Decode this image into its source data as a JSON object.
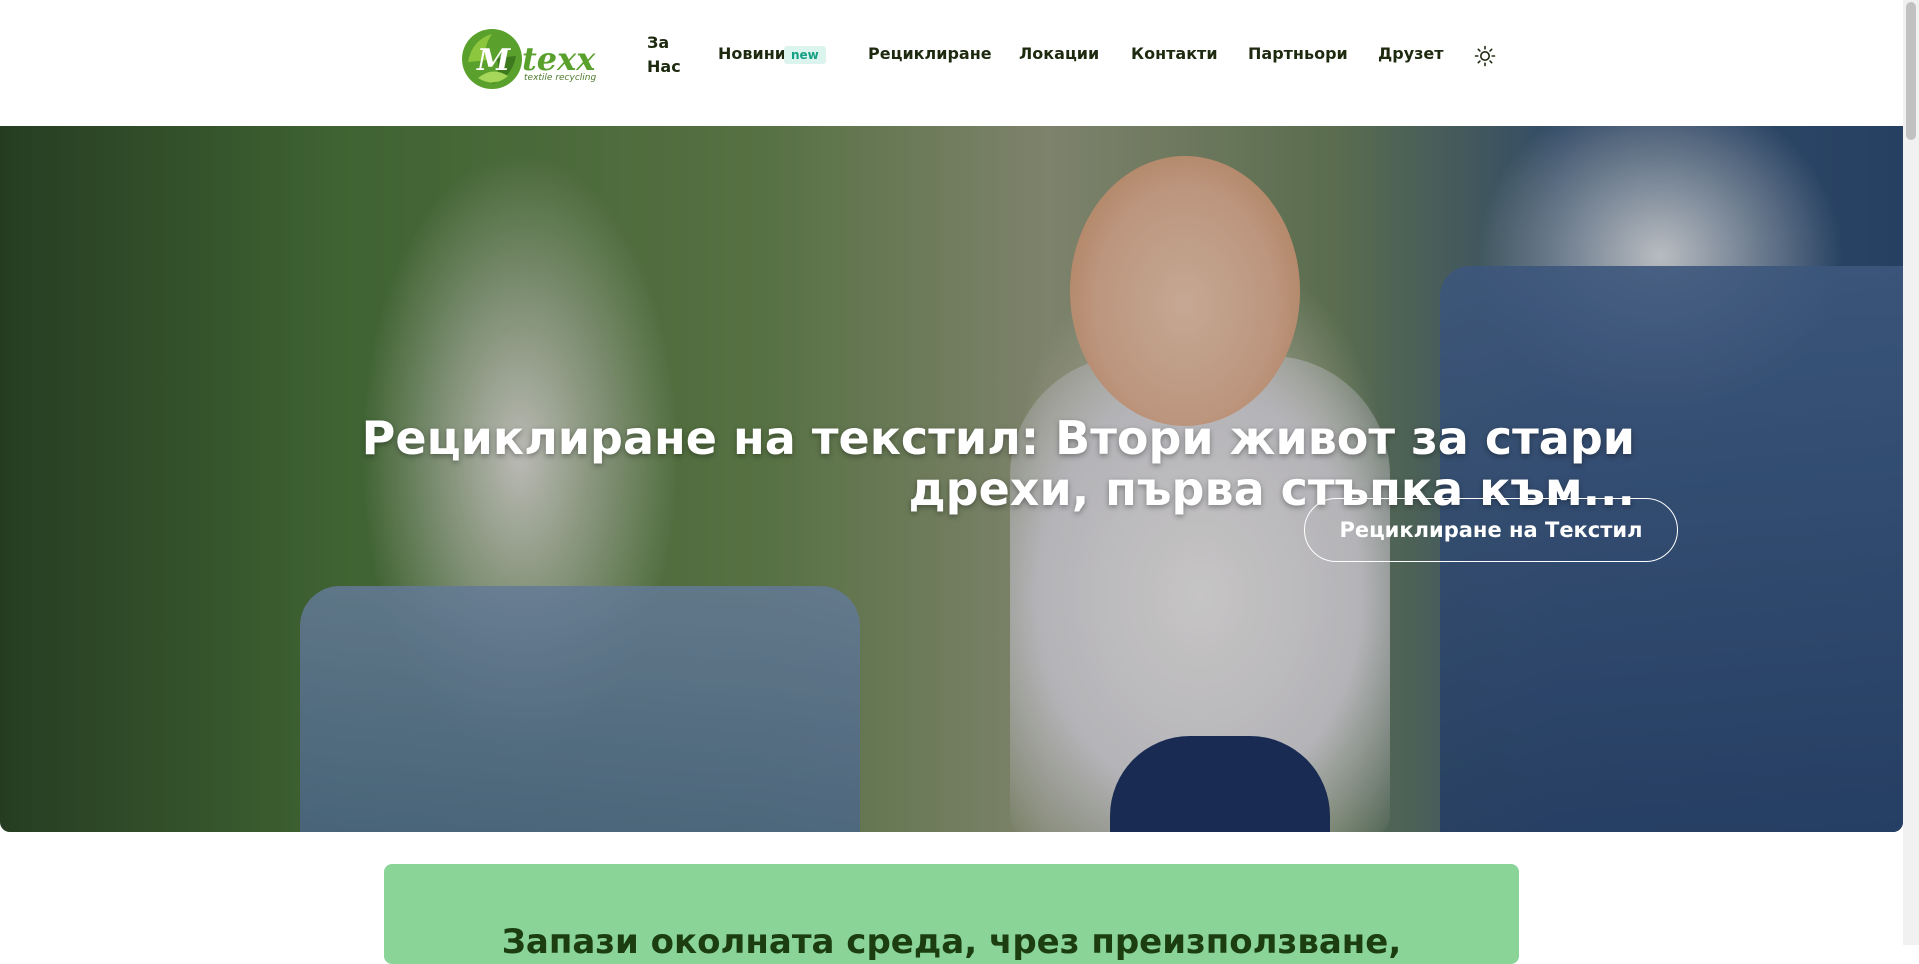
{
  "brand": {
    "name": "texx",
    "tagline": "textile recycling",
    "logo_icon": "recycle-leaf-m-logo",
    "accent_color": "#5aa02c"
  },
  "nav": {
    "about": "За Нас",
    "news": "Новини",
    "news_badge": "new",
    "recycling": "Рециклиране",
    "locations": "Локации",
    "contacts": "Контакти",
    "partners": "Партньори",
    "other": "Друзет",
    "theme_icon": "sun-icon"
  },
  "hero": {
    "title": "Рециклиране на текстил: Втори живот за стари дрехи, първа стъпка към...",
    "button_label": "Рециклиране на Текстил"
  },
  "section": {
    "title": "Запази околната среда, чрез преизползване,",
    "background_color": "#8ad498"
  }
}
